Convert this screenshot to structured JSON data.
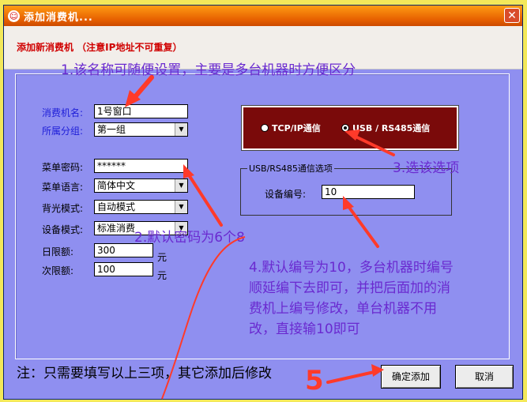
{
  "window": {
    "title": "添加消费机...",
    "header": "添加新消费机 （注意IP地址不可重复）",
    "close_label": "✕"
  },
  "form": {
    "name_label": "消费机名:",
    "name_value": "1号窗口",
    "group_label": "所属分组:",
    "group_value": "第一组",
    "password_label": "菜单密码:",
    "password_value": "******",
    "language_label": "菜单语言:",
    "language_value": "简体中文",
    "backlight_label": "背光模式:",
    "backlight_value": "自动模式",
    "device_mode_label": "设备模式:",
    "device_mode_value": "标准消费",
    "daily_limit_label": "日限额:",
    "daily_limit_value": "300",
    "daily_limit_unit": "元",
    "single_limit_label": "次限额:",
    "single_limit_value": "100",
    "single_limit_unit": "元"
  },
  "connection": {
    "tcp_label": "TCP/IP通信",
    "usb_label": "USB / RS485通信",
    "selected": "usb"
  },
  "usb_options": {
    "legend": "USB/RS485通信选项",
    "device_no_label": "设备编号:",
    "device_no_value": "10"
  },
  "note": "注：只需要填写以上三项，其它添加后修改",
  "buttons": {
    "confirm": "确定添加",
    "cancel": "取消"
  },
  "annotations": {
    "a1": "1.该名称可随便设置，主要是多台机器时方便区分",
    "a2": "2.默认密码为6个8",
    "a3": "3.选该选项",
    "a4_line1": "4.默认编号为10，多台机器时编号",
    "a4_line2": "顺延编下去即可，并把后面加的消",
    "a4_line3": "费机上编号修改，单台机器不用",
    "a4_line4": "改，直接输10即可",
    "a5": "5"
  },
  "colors": {
    "dialog_bg": "#8f8ff0",
    "title_bar": "#e65f00",
    "header_text": "#d00000",
    "connection_box": "#7a0a0a",
    "annotation_text": "#6a2ad0",
    "annotation_arrow": "#ff3a2a",
    "field_label_blue": "#1d1dd8"
  },
  "icons": {
    "title": "app-emblem-icon",
    "close": "close-icon",
    "dropdown": "chevron-down-icon"
  }
}
